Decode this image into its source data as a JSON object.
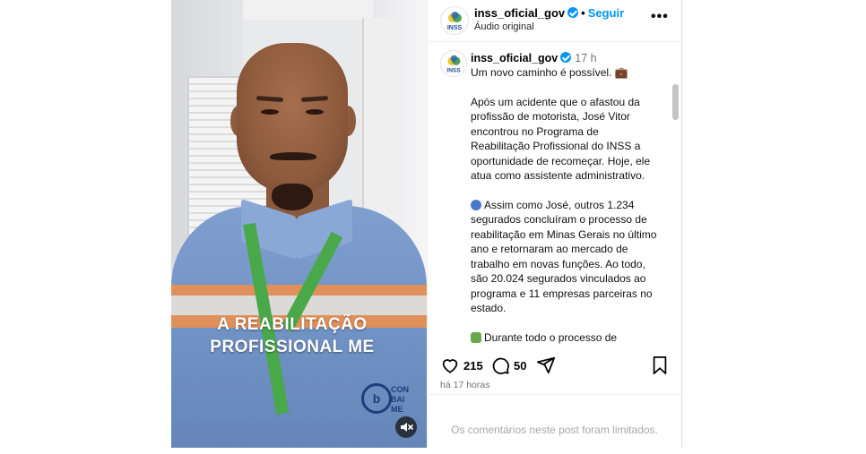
{
  "video": {
    "caption_line1": "A REABILITAÇÃO",
    "caption_line2": "PROFISSIONAL ME",
    "badge_line1": "CON",
    "badge_line2": "BAI",
    "badge_line3": "ME",
    "mute_icon": "speaker-muted-icon"
  },
  "header": {
    "username": "inss_oficial_gov",
    "dot": "•",
    "follow_label": "Seguir",
    "audio_label": "Áudio original",
    "more_label": "•••"
  },
  "post": {
    "username": "inss_oficial_gov",
    "time": "17 h",
    "paragraph1": "Um novo caminho é possível. 💼",
    "paragraph2": "Após um acidente que o afastou da profissão de motorista, José Vitor encontrou no Programa de Reabilitação Profissional do INSS a oportunidade de recomeçar. Hoje, ele atua como assistente administrativo.",
    "paragraph3": "Assim como José, outros 1.234 segurados concluíram o processo de reabilitação em Minas Gerais no último ano e retornaram ao mercado de trabalho em novas funções. Ao todo, são 20.024 segurados vinculados ao programa e 11 empresas parceiras no estado.",
    "paragraph4": "Durante todo o processo de reabilitação, o segurado recebe orientação, faz cursos e mantém o"
  },
  "actions": {
    "likes": "215",
    "comments": "50",
    "time_ago": "há 17 horas",
    "limited_text": "Os comentários neste post foram limitados."
  },
  "colors": {
    "accent": "#0095f6",
    "muted_text": "#737373"
  }
}
